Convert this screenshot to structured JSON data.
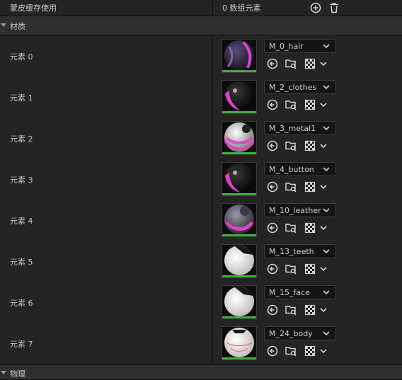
{
  "header": {
    "label": "蒙皮缓存使用",
    "value": "0 数组元素",
    "add_icon": "add-circle-icon",
    "delete_icon": "trash-icon"
  },
  "materials_section": {
    "title": "材质",
    "rows": [
      {
        "label": "元素 0",
        "material": "M_0_hair",
        "preview": "hair-dark-purple"
      },
      {
        "label": "元素 1",
        "material": "M_2_clothes",
        "preview": "pink-black"
      },
      {
        "label": "元素 2",
        "material": "M_3_metal1",
        "preview": "pink-metal"
      },
      {
        "label": "元素 3",
        "material": "M_4_button",
        "preview": "pink-black"
      },
      {
        "label": "元素 4",
        "material": "M_10_leather",
        "preview": "pink-leather"
      },
      {
        "label": "元素 5",
        "material": "M_13_teeth",
        "preview": "white"
      },
      {
        "label": "元素 6",
        "material": "M_15_face",
        "preview": "white"
      },
      {
        "label": "元素 7",
        "material": "M_24_body",
        "preview": "white-body"
      }
    ]
  },
  "next_section": {
    "title": "物理"
  },
  "row_tools": [
    "reset-arrow-icon",
    "browse-folder-icon",
    "checker-icon",
    "chevron-down-icon"
  ],
  "colors": {
    "accent_green": "#3cae3c",
    "pink": "#e040c8"
  }
}
